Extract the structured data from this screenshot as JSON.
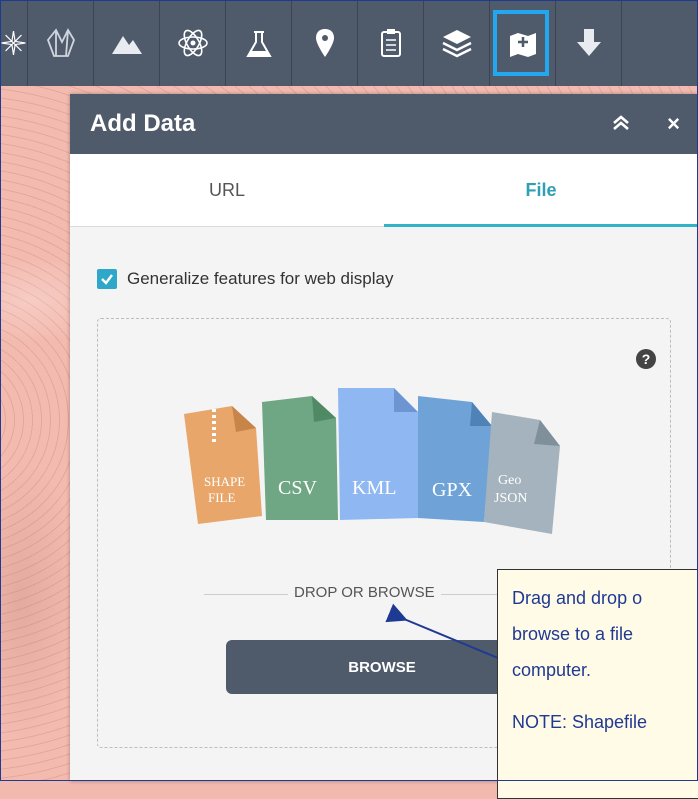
{
  "toolbar": {
    "tools": [
      {
        "icon": "compass-star-icon"
      },
      {
        "icon": "crystal-icon"
      },
      {
        "icon": "mountain-icon"
      },
      {
        "icon": "atom-icon"
      },
      {
        "icon": "flask-icon"
      },
      {
        "icon": "map-pin-icon"
      },
      {
        "icon": "clipboard-icon"
      },
      {
        "icon": "layers-icon"
      },
      {
        "icon": "add-data-icon",
        "active": true
      },
      {
        "icon": "download-icon"
      }
    ],
    "active_color": "#22a7f0"
  },
  "panel": {
    "title": "Add Data",
    "collapse_glyph": "≪",
    "close_glyph": "×",
    "tabs": [
      {
        "label": "URL",
        "active": false
      },
      {
        "label": "File",
        "active": true
      }
    ],
    "generalize_label": "Generalize features for web display",
    "generalize_checked": true,
    "help_glyph": "?",
    "file_types": [
      "SHAPE FILE",
      "CSV",
      "KML",
      "GPX",
      "Geo JSON"
    ],
    "drop_text": "DROP OR BROWSE",
    "browse_label": "BROWSE"
  },
  "callout": {
    "line1": "Drag and drop o",
    "line2": "browse to a file",
    "line3": "computer.",
    "note": "NOTE: Shapefile"
  },
  "colors": {
    "header": "#4f5a6b",
    "accent": "#2fb3c7",
    "map": "#f3bbb0"
  }
}
